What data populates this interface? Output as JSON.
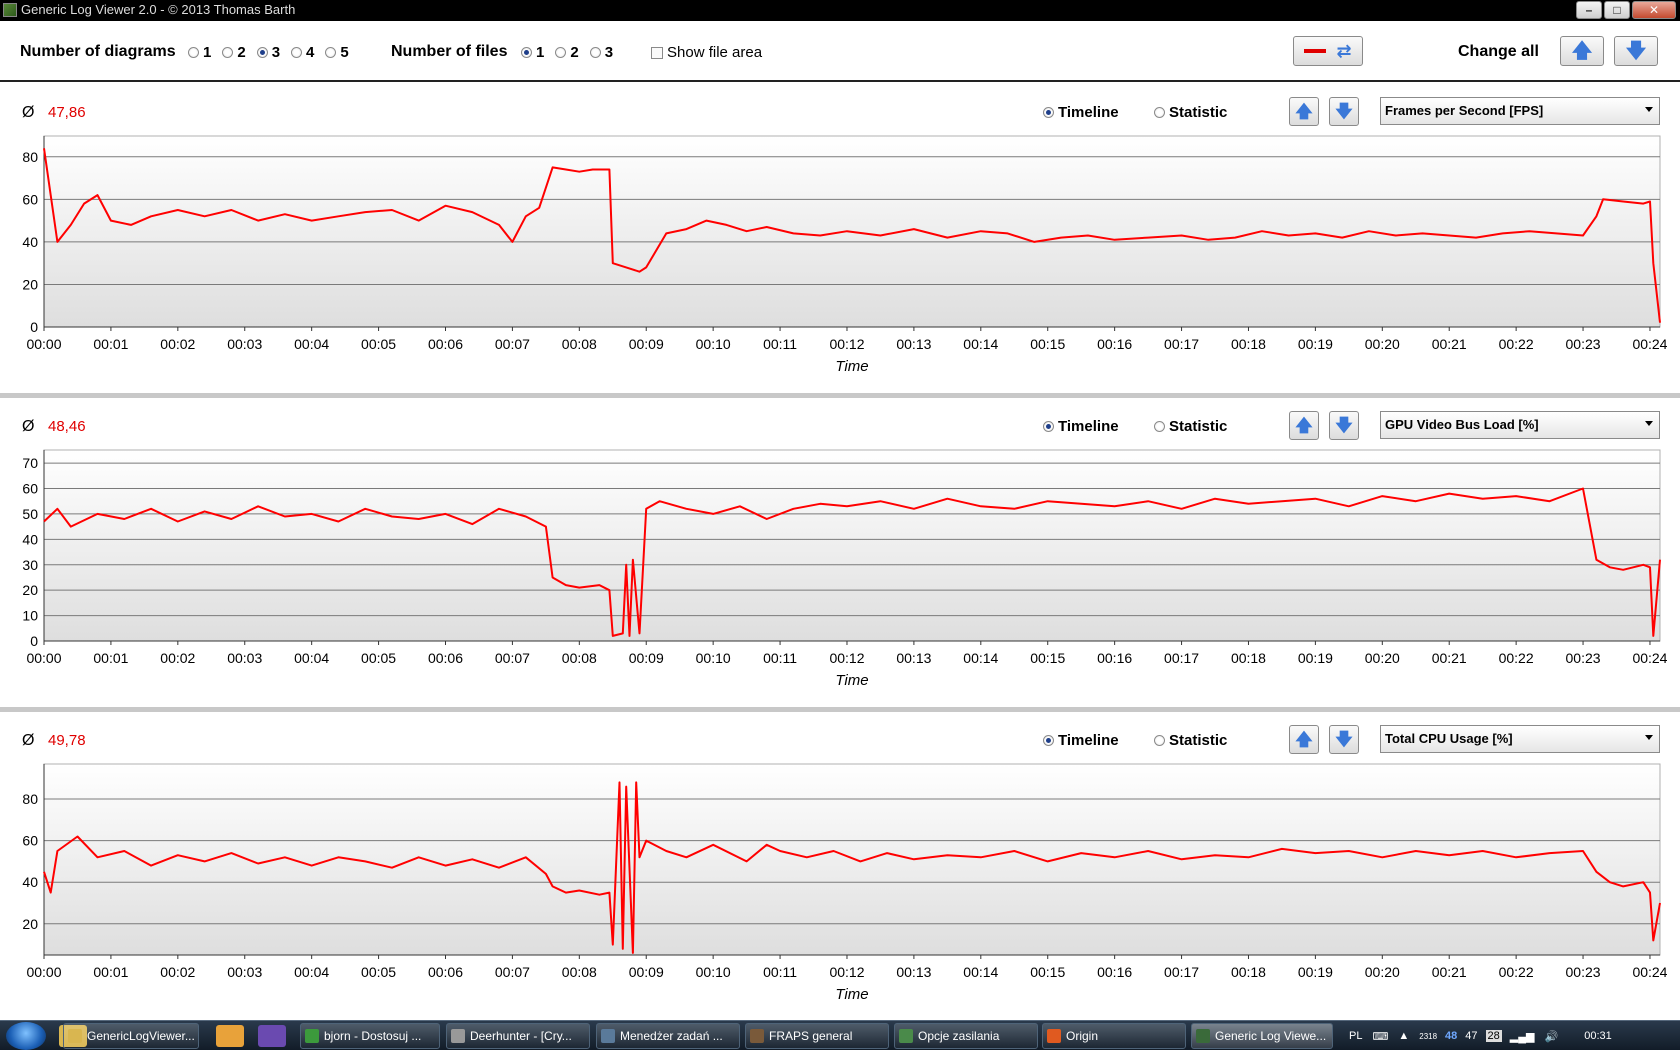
{
  "window": {
    "title": "Generic Log Viewer 2.0 - © 2013 Thomas Barth"
  },
  "toolbar": {
    "diagrams_label": "Number of diagrams",
    "diagram_options": [
      "1",
      "2",
      "3",
      "4",
      "5"
    ],
    "diagrams_selected": "3",
    "files_label": "Number of files",
    "file_options": [
      "1",
      "2",
      "3"
    ],
    "files_selected": "1",
    "show_file_area": "Show file area",
    "change_all": "Change all"
  },
  "diagrams": [
    {
      "avg_symbol": "Ø",
      "average": "47,86",
      "timeline": "Timeline",
      "statistic": "Statistic",
      "selected_mode": "Timeline",
      "metric": "Frames per Second [FPS]",
      "line_color": "#ff0000"
    },
    {
      "avg_symbol": "Ø",
      "average": "48,46",
      "timeline": "Timeline",
      "statistic": "Statistic",
      "selected_mode": "Timeline",
      "metric": "GPU Video Bus Load [%]",
      "line_color": "#ff0000"
    },
    {
      "avg_symbol": "Ø",
      "average": "49,78",
      "timeline": "Timeline",
      "statistic": "Statistic",
      "selected_mode": "Timeline",
      "metric": "Total CPU Usage [%]",
      "line_color": "#ff0000"
    }
  ],
  "chart_data": [
    {
      "type": "line",
      "xlabel": "Time",
      "x_ticks": [
        "00:00",
        "00:01",
        "00:02",
        "00:03",
        "00:04",
        "00:05",
        "00:06",
        "00:07",
        "00:08",
        "00:09",
        "00:10",
        "00:11",
        "00:12",
        "00:13",
        "00:14",
        "00:15",
        "00:16",
        "00:17",
        "00:18",
        "00:19",
        "00:20",
        "00:21",
        "00:22",
        "00:23",
        "00:24"
      ],
      "y_ticks": [
        0,
        20,
        40,
        60,
        80
      ],
      "ylim": [
        0,
        86
      ],
      "xlim": [
        0,
        24.15
      ],
      "grid": true,
      "series": [
        {
          "x": [
            0,
            0.1,
            0.2,
            0.4,
            0.6,
            0.8,
            1.0,
            1.3,
            1.6,
            2.0,
            2.4,
            2.8,
            3.2,
            3.6,
            4.0,
            4.4,
            4.8,
            5.2,
            5.6,
            6.0,
            6.4,
            6.8,
            7.0,
            7.2,
            7.4,
            7.6,
            7.8,
            8.0,
            8.2,
            8.45,
            8.5,
            8.7,
            8.9,
            9.0,
            9.3,
            9.6,
            9.9,
            10.2,
            10.5,
            10.8,
            11.2,
            11.6,
            12.0,
            12.5,
            13.0,
            13.5,
            14.0,
            14.4,
            14.8,
            15.2,
            15.6,
            16.0,
            16.5,
            17.0,
            17.4,
            17.8,
            18.2,
            18.6,
            19.0,
            19.4,
            19.8,
            20.2,
            20.6,
            21.0,
            21.4,
            21.8,
            22.2,
            22.6,
            23.0,
            23.2,
            23.3,
            23.6,
            23.9,
            24.0,
            24.05,
            24.15
          ],
          "y": [
            84,
            62,
            40,
            48,
            58,
            62,
            50,
            48,
            52,
            55,
            52,
            55,
            50,
            53,
            50,
            52,
            54,
            55,
            50,
            57,
            54,
            48,
            40,
            52,
            56,
            75,
            74,
            73,
            74,
            74,
            30,
            28,
            26,
            28,
            44,
            46,
            50,
            48,
            45,
            47,
            44,
            43,
            45,
            43,
            46,
            42,
            45,
            44,
            40,
            42,
            43,
            41,
            42,
            43,
            41,
            42,
            45,
            43,
            44,
            42,
            45,
            43,
            44,
            43,
            42,
            44,
            45,
            44,
            43,
            52,
            60,
            59,
            58,
            59,
            30,
            2
          ]
        }
      ]
    },
    {
      "type": "line",
      "xlabel": "Time",
      "x_ticks": [
        "00:00",
        "00:01",
        "00:02",
        "00:03",
        "00:04",
        "00:05",
        "00:06",
        "00:07",
        "00:08",
        "00:09",
        "00:10",
        "00:11",
        "00:12",
        "00:13",
        "00:14",
        "00:15",
        "00:16",
        "00:17",
        "00:18",
        "00:19",
        "00:20",
        "00:21",
        "00:22",
        "00:23",
        "00:24"
      ],
      "y_ticks": [
        0,
        10,
        20,
        30,
        40,
        50,
        60,
        70
      ],
      "ylim": [
        0,
        72
      ],
      "xlim": [
        0,
        24.15
      ],
      "grid": true,
      "series": [
        {
          "x": [
            0,
            0.2,
            0.4,
            0.8,
            1.2,
            1.6,
            2.0,
            2.4,
            2.8,
            3.2,
            3.6,
            4.0,
            4.4,
            4.8,
            5.2,
            5.6,
            6.0,
            6.4,
            6.8,
            7.2,
            7.5,
            7.6,
            7.8,
            8.0,
            8.3,
            8.45,
            8.5,
            8.65,
            8.7,
            8.75,
            8.8,
            8.9,
            9.0,
            9.2,
            9.6,
            10.0,
            10.4,
            10.8,
            11.2,
            11.6,
            12.0,
            12.5,
            13.0,
            13.5,
            14.0,
            14.5,
            15.0,
            15.5,
            16.0,
            16.5,
            17.0,
            17.5,
            18.0,
            18.5,
            19.0,
            19.5,
            20.0,
            20.5,
            21.0,
            21.5,
            22.0,
            22.5,
            23.0,
            23.2,
            23.4,
            23.6,
            23.9,
            24.0,
            24.05,
            24.15
          ],
          "y": [
            47,
            52,
            45,
            50,
            48,
            52,
            47,
            51,
            48,
            53,
            49,
            50,
            47,
            52,
            49,
            48,
            50,
            46,
            52,
            49,
            45,
            25,
            22,
            21,
            22,
            20,
            2,
            3,
            30,
            2,
            32,
            3,
            52,
            55,
            52,
            50,
            53,
            48,
            52,
            54,
            53,
            55,
            52,
            56,
            53,
            52,
            55,
            54,
            53,
            55,
            52,
            56,
            54,
            55,
            56,
            53,
            57,
            55,
            58,
            56,
            57,
            55,
            60,
            32,
            29,
            28,
            30,
            29,
            2,
            32
          ]
        }
      ]
    },
    {
      "type": "line",
      "xlabel": "Time",
      "x_ticks": [
        "00:00",
        "00:01",
        "00:02",
        "00:03",
        "00:04",
        "00:05",
        "00:06",
        "00:07",
        "00:08",
        "00:09",
        "00:10",
        "00:11",
        "00:12",
        "00:13",
        "00:14",
        "00:15",
        "00:16",
        "00:17",
        "00:18",
        "00:19",
        "00:20",
        "00:21",
        "00:22",
        "00:23",
        "00:24"
      ],
      "y_ticks": [
        20,
        40,
        60,
        80
      ],
      "ylim": [
        5,
        93
      ],
      "xlim": [
        0,
        24.15
      ],
      "grid": true,
      "series": [
        {
          "x": [
            0,
            0.1,
            0.2,
            0.5,
            0.8,
            1.2,
            1.6,
            2.0,
            2.4,
            2.8,
            3.2,
            3.6,
            4.0,
            4.4,
            4.8,
            5.2,
            5.6,
            6.0,
            6.4,
            6.8,
            7.2,
            7.5,
            7.6,
            7.8,
            8.0,
            8.3,
            8.45,
            8.5,
            8.6,
            8.65,
            8.7,
            8.8,
            8.85,
            8.9,
            9.0,
            9.3,
            9.6,
            10.0,
            10.5,
            10.8,
            11.0,
            11.4,
            11.8,
            12.2,
            12.6,
            13.0,
            13.5,
            14.0,
            14.5,
            15.0,
            15.5,
            16.0,
            16.5,
            17.0,
            17.5,
            18.0,
            18.5,
            19.0,
            19.5,
            20.0,
            20.5,
            21.0,
            21.5,
            22.0,
            22.5,
            23.0,
            23.2,
            23.4,
            23.6,
            23.9,
            24.0,
            24.05,
            24.15
          ],
          "y": [
            45,
            35,
            55,
            62,
            52,
            55,
            48,
            53,
            50,
            54,
            49,
            52,
            48,
            52,
            50,
            47,
            52,
            48,
            51,
            47,
            52,
            44,
            38,
            35,
            36,
            34,
            35,
            10,
            88,
            8,
            86,
            6,
            88,
            52,
            60,
            55,
            52,
            58,
            50,
            58,
            55,
            52,
            55,
            50,
            54,
            51,
            53,
            52,
            55,
            50,
            54,
            52,
            55,
            51,
            53,
            52,
            56,
            54,
            55,
            52,
            55,
            53,
            55,
            52,
            54,
            55,
            45,
            40,
            38,
            40,
            35,
            12,
            30
          ]
        }
      ]
    }
  ],
  "taskbar": {
    "tasks": [
      "GenericLogViewer...",
      "bjorn - Dostosuj ...",
      "Deerhunter - [Cry...",
      "Menedżer zadań ...",
      "FRAPS general",
      "Opcje zasilania",
      "Origin",
      "Generic Log Viewe..."
    ],
    "tray_lang": "PL",
    "tray_num1": "2318",
    "tray_num2": "48",
    "tray_num3": "47",
    "tray_num4": "28",
    "clock": "00:31"
  }
}
